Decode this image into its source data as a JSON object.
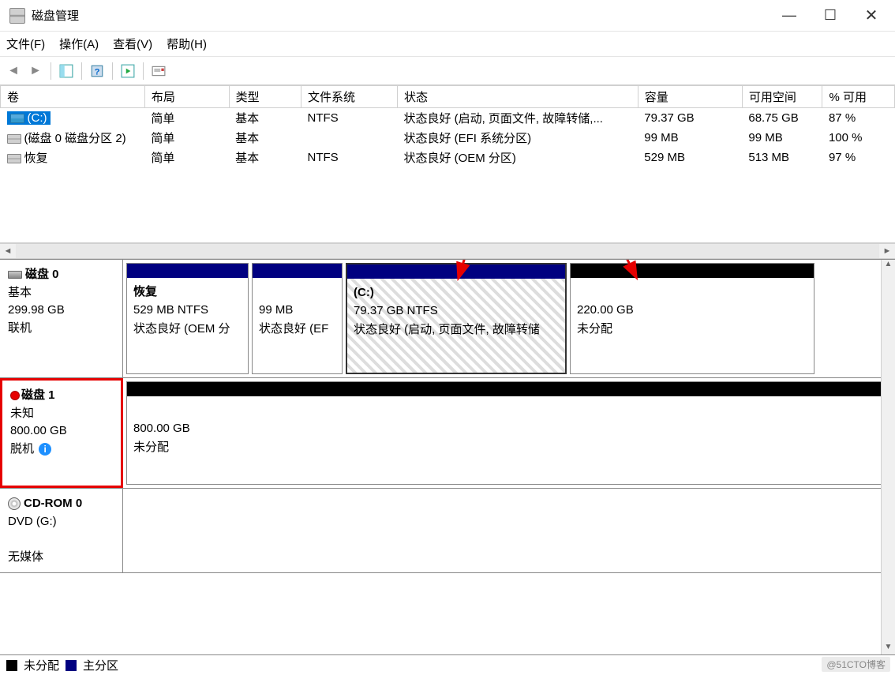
{
  "window": {
    "title": "磁盘管理"
  },
  "menu": {
    "file": "文件(F)",
    "action": "操作(A)",
    "view": "查看(V)",
    "help": "帮助(H)"
  },
  "table": {
    "headers": {
      "volume": "卷",
      "layout": "布局",
      "type": "类型",
      "fs": "文件系统",
      "status": "状态",
      "capacity": "容量",
      "free": "可用空间",
      "pct": "% 可用"
    },
    "rows": [
      {
        "volume": "(C:)",
        "layout": "简单",
        "type": "基本",
        "fs": "NTFS",
        "status": "状态良好 (启动, 页面文件, 故障转储,...",
        "capacity": "79.37 GB",
        "free": "68.75 GB",
        "pct": "87 %"
      },
      {
        "volume": "(磁盘 0 磁盘分区 2)",
        "layout": "简单",
        "type": "基本",
        "fs": "",
        "status": "状态良好 (EFI 系统分区)",
        "capacity": "99 MB",
        "free": "99 MB",
        "pct": "100 %"
      },
      {
        "volume": "恢复",
        "layout": "简单",
        "type": "基本",
        "fs": "NTFS",
        "status": "状态良好 (OEM 分区)",
        "capacity": "529 MB",
        "free": "513 MB",
        "pct": "97 %"
      }
    ]
  },
  "disks": {
    "d0": {
      "name": "磁盘 0",
      "type": "基本",
      "size": "299.98 GB",
      "status": "联机",
      "parts": {
        "p0": {
          "name": "恢复",
          "line2": "529 MB NTFS",
          "line3": "状态良好 (OEM 分"
        },
        "p1": {
          "name": "",
          "line2": "99 MB",
          "line3": "状态良好 (EF"
        },
        "p2": {
          "name": "(C:)",
          "line2": "79.37 GB NTFS",
          "line3": "状态良好 (启动, 页面文件, 故障转储"
        },
        "p3": {
          "name": "",
          "line2": "220.00 GB",
          "line3": "未分配"
        }
      }
    },
    "d1": {
      "name": "磁盘 1",
      "type": "未知",
      "size": "800.00 GB",
      "status": "脱机",
      "parts": {
        "p0": {
          "name": "",
          "line2": "800.00 GB",
          "line3": "未分配"
        }
      }
    },
    "cd": {
      "name": "CD-ROM 0",
      "type": "DVD (G:)",
      "status": "无媒体"
    }
  },
  "legend": {
    "unalloc": "未分配",
    "primary": "主分区"
  },
  "watermark": "@51CTO博客"
}
